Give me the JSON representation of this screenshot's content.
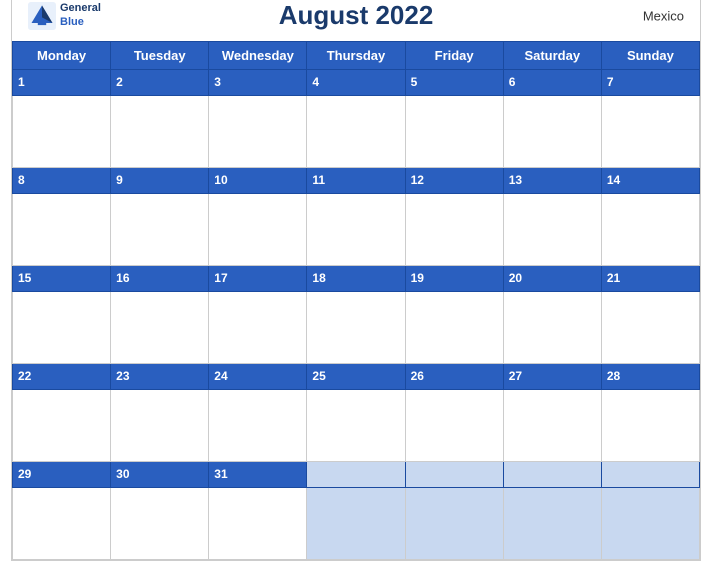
{
  "header": {
    "title": "August 2022",
    "country": "Mexico",
    "logo_line1": "General",
    "logo_line2": "Blue"
  },
  "weekdays": [
    "Monday",
    "Tuesday",
    "Wednesday",
    "Thursday",
    "Friday",
    "Saturday",
    "Sunday"
  ],
  "weeks": [
    {
      "dates": [
        1,
        2,
        3,
        4,
        5,
        6,
        7
      ]
    },
    {
      "dates": [
        8,
        9,
        10,
        11,
        12,
        13,
        14
      ]
    },
    {
      "dates": [
        15,
        16,
        17,
        18,
        19,
        20,
        21
      ]
    },
    {
      "dates": [
        22,
        23,
        24,
        25,
        26,
        27,
        28
      ]
    },
    {
      "dates": [
        29,
        30,
        31,
        null,
        null,
        null,
        null
      ]
    }
  ],
  "colors": {
    "header_bg": "#2a5fbf",
    "header_text": "#ffffff",
    "title_color": "#1a3a6b",
    "date_color": "#1a3a6b",
    "empty_bg": "#c8d8f0"
  }
}
